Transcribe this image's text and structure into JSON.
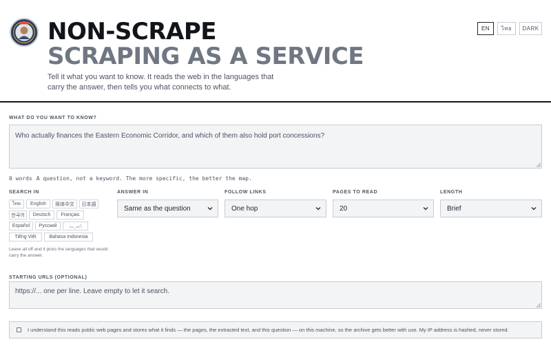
{
  "header": {
    "title": "NON-SCRAPE",
    "subtitle": "SCRAPING AS A SERVICE",
    "tagline": "Tell it what you want to know. It reads the web in the languages that carry the answer, then tells you what connects to what.",
    "language_buttons": [
      "EN",
      "ไทย",
      "DARK"
    ],
    "active_language": "EN"
  },
  "question": {
    "label": "WHAT DO YOU WANT TO KNOW?",
    "value": "Who actually finances the Eastern Economic Corridor, and which of them also hold port concessions?",
    "word_count": "0 words",
    "hint": "A question, not a keyword. The more specific, the better the map."
  },
  "search_in": {
    "label": "SEARCH IN",
    "languages": [
      "ไทย",
      "English",
      "简体中文",
      "日本語",
      "한국어",
      "Deutsch",
      "Français",
      "Español",
      "Русский",
      "العربية",
      "Tiếng Việt",
      "Bahasa Indonesia"
    ],
    "note": "Leave all off and it picks the languages that would carry the answer."
  },
  "answer_in": {
    "label": "ANSWER IN",
    "value": "Same as the question"
  },
  "follow_links": {
    "label": "FOLLOW LINKS",
    "value": "One hop"
  },
  "pages_to_read": {
    "label": "PAGES TO READ",
    "value": "20"
  },
  "length": {
    "label": "LENGTH",
    "value": "Brief"
  },
  "starting_urls": {
    "label": "STARTING URLS (OPTIONAL)",
    "placeholder": "https://... one per line. Leave empty to let it search."
  },
  "consent": {
    "text": "I understand this reads public web pages and stores what it finds — the pages, the extracted text, and this question — on this machine, so the archive gets better with use. My IP address is hashed, never stored.",
    "checked": false
  },
  "colors": {
    "ink": "#111418",
    "muted": "#707782",
    "field": "#f2f4f6",
    "border": "#c7ccd3"
  },
  "icons": {
    "logo": "seal-logo-icon",
    "select": "chevron-down-icon",
    "resize": "resize-handle-icon"
  }
}
